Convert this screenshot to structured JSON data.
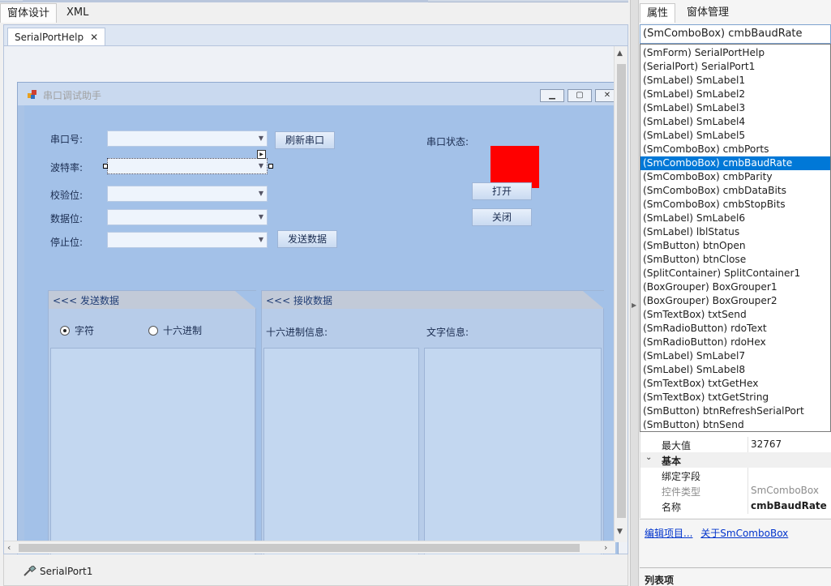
{
  "main_tabs": [
    {
      "label": "窗体设计"
    },
    {
      "label": "XML"
    }
  ],
  "file_tab": {
    "label": "SerialPortHelp",
    "close": "✕"
  },
  "form": {
    "title": "串口调试助手",
    "controls": {
      "port_label": "串口号:",
      "baud_label": "波特率:",
      "parity_label": "校验位:",
      "databits_label": "数据位:",
      "stopbits_label": "停止位:",
      "refresh_button": "刷新串口",
      "send_button": "发送数据",
      "status_label": "串口状态:",
      "status_color": "#ff0000",
      "open_button": "打开",
      "close_button": "关闭"
    },
    "send_group": {
      "title": "<<< 发送数据",
      "radio_text": "字符",
      "radio_hex": "十六进制",
      "selected": "字符"
    },
    "recv_group": {
      "title": "<<< 接收数据",
      "hex_label": "十六进制信息:",
      "text_label": "文字信息:"
    }
  },
  "tray": {
    "item": "SerialPort1"
  },
  "right_panel": {
    "tabs": [
      {
        "label": "属性"
      },
      {
        "label": "窗体管理"
      }
    ],
    "selected_object": "(SmComboBox) cmbBaudRate",
    "objects": [
      "(SmForm) SerialPortHelp",
      "(SerialPort) SerialPort1",
      "(SmLabel) SmLabel1",
      "(SmLabel) SmLabel2",
      "(SmLabel) SmLabel3",
      "(SmLabel) SmLabel4",
      "(SmLabel) SmLabel5",
      "(SmComboBox) cmbPorts",
      "(SmComboBox) cmbBaudRate",
      "(SmComboBox) cmbParity",
      "(SmComboBox) cmbDataBits",
      "(SmComboBox) cmbStopBits",
      "(SmLabel) SmLabel6",
      "(SmLabel) lblStatus",
      "(SmButton) btnOpen",
      "(SmButton) btnClose",
      "(SplitContainer) SplitContainer1",
      "(BoxGrouper) BoxGrouper1",
      "(BoxGrouper) BoxGrouper2",
      "(SmTextBox) txtSend",
      "(SmRadioButton) rdoText",
      "(SmRadioButton) rdoHex",
      "(SmLabel) SmLabel7",
      "(SmLabel) SmLabel8",
      "(SmTextBox) txtGetHex",
      "(SmTextBox) txtGetString",
      "(SmButton) btnRefreshSerialPort",
      "(SmButton) btnSend"
    ],
    "selected_index": 8,
    "properties": {
      "max_label": "最大值",
      "max_value": "32767",
      "basic_category": "基本",
      "bind_label": "绑定字段",
      "bind_value": "",
      "type_label": "控件类型",
      "type_value": "SmComboBox",
      "name_label": "名称",
      "name_value": "cmbBaudRate"
    },
    "links": {
      "edit": "编辑项目...",
      "about": "关于SmComboBox"
    },
    "description_title": "列表项"
  }
}
